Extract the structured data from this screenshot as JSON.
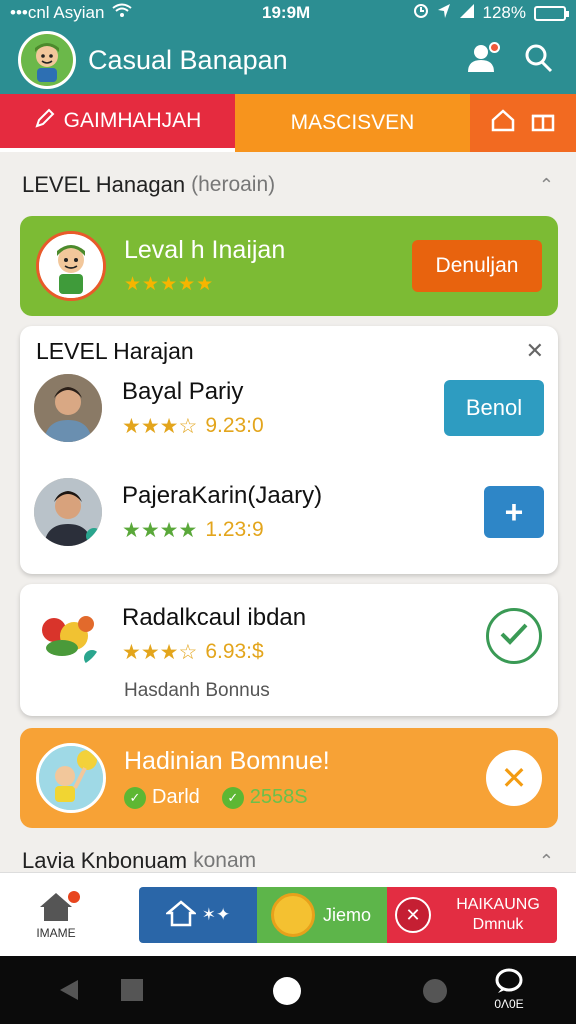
{
  "status_bar": {
    "carrier": "•••cnl Asyian",
    "time": "19:9M",
    "battery": "128%"
  },
  "app_bar": {
    "title": "Casual Banapan"
  },
  "tabs": [
    {
      "label": "GAIMHAHJAH"
    },
    {
      "label": "MASCISVEN"
    }
  ],
  "section1": {
    "title": "LEVEL Hanagan",
    "sub": "(heroain)"
  },
  "level_card": {
    "name": "Leval h Inaijan",
    "stars": "★★★★★",
    "button": "Denuljan"
  },
  "players_card": {
    "title": "LEVEL Harajan",
    "rows": [
      {
        "name": "Bayal Pariy",
        "stars": "★★★☆",
        "score": "9.23:0",
        "button": "Benol"
      },
      {
        "name": "PajeraKarin(Jaary)",
        "stars": "★★★★",
        "score": "1.23:9",
        "button": "+"
      }
    ]
  },
  "food_card": {
    "name": "Radalkcaul ibdan",
    "stars": "★★★☆",
    "score": "6.93:$",
    "bonus": "Hasdanh Bonnus"
  },
  "bonus_card": {
    "title": "Hadinian Bomnue!",
    "item1": "Darld",
    "item2": "2558S"
  },
  "section2": {
    "title": "Lavia Knbonuam",
    "sub": "konam"
  },
  "bottom_nav": {
    "home_label": "IMAME",
    "promo_mid": "Jiemo",
    "promo_right_line1": "HAIKAUNG",
    "promo_right_line2": "Dmnuk"
  },
  "sys_nav": {
    "right_label": "0Λ0E"
  },
  "colors": {
    "teal": "#2c8e92",
    "red": "#e52b3f",
    "orange": "#f7941d",
    "green": "#7cbb34",
    "amber": "#f7a236"
  }
}
